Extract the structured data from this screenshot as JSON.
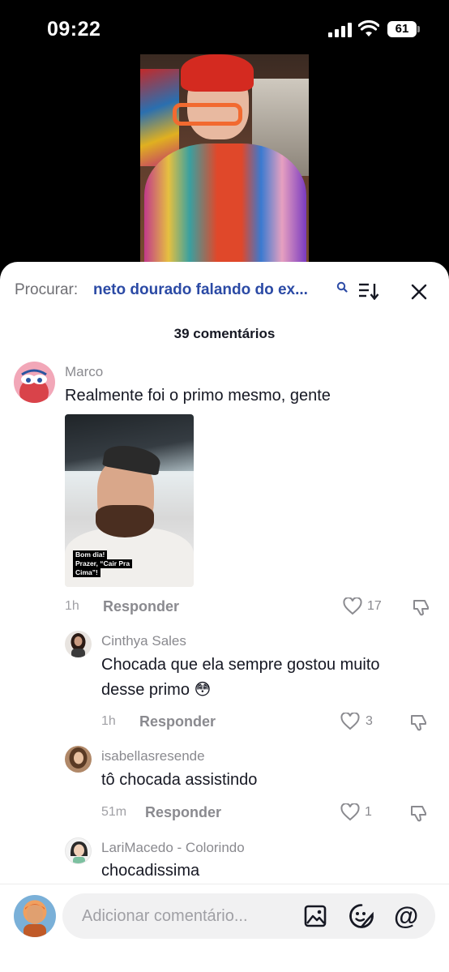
{
  "status": {
    "time": "09:22",
    "battery": "61"
  },
  "search": {
    "prefix": "Procurar:",
    "query": "neto dourado falando do ex..."
  },
  "comments_count": "39 comentários",
  "reply_label": "Responder",
  "comments": [
    {
      "user": "Marco",
      "text": "Realmente foi o primo mesmo, gente",
      "time": "1h",
      "likes": "17",
      "attachment": {
        "caption": [
          "Bom dia!",
          "Prazer, “Cair Pra",
          "Cima”!"
        ]
      }
    },
    {
      "user": "Cinthya Sales",
      "text": "Chocada que ela sempre gostou muito desse primo 😳",
      "time": "1h",
      "likes": "3"
    },
    {
      "user": "isabellasresende",
      "text": "tô chocada assistindo",
      "time": "51m",
      "likes": "1"
    },
    {
      "user": "LariMacedo - Colorindo",
      "text": "chocadissima"
    }
  ],
  "composer": {
    "placeholder": "Adicionar comentário..."
  },
  "colors": {
    "link_blue": "#2b4aa5",
    "text": "#161823",
    "muted": "#8a8a8f"
  }
}
